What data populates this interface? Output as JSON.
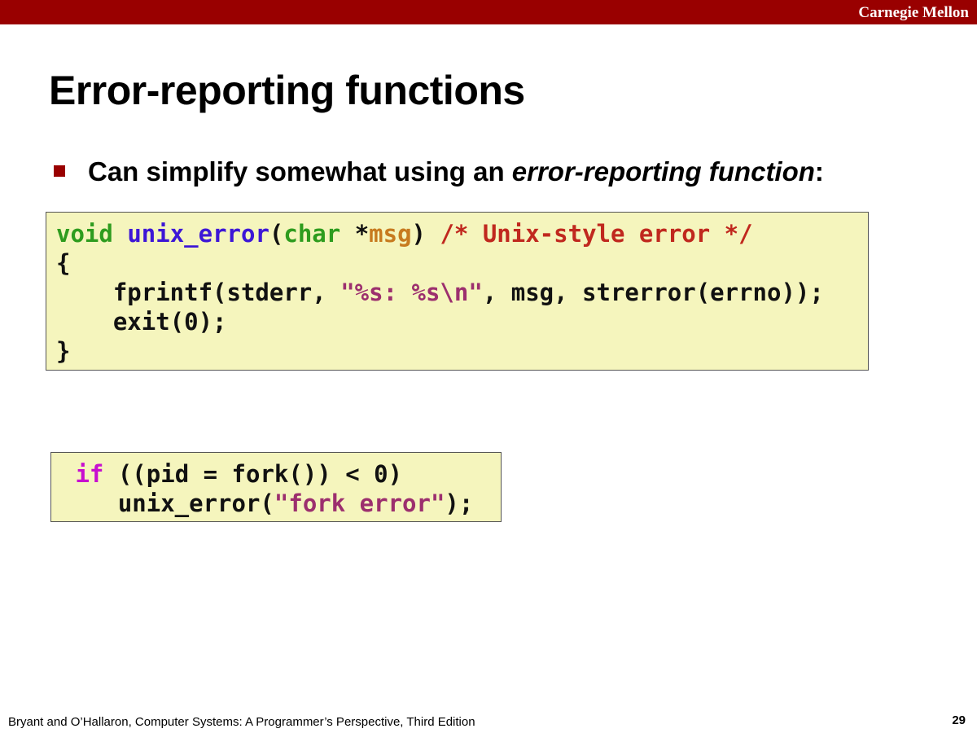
{
  "header": {
    "brand": "Carnegie Mellon"
  },
  "slide": {
    "title": "Error-reporting functions",
    "bullet": {
      "before": "Can simplify somewhat using an ",
      "emphasis": "error-reporting function",
      "after": ":"
    },
    "code_block_1": {
      "line1": {
        "t1": "void",
        "t2": " ",
        "t3": "unix_error",
        "t4": "(",
        "t5": "char",
        "t6": " *",
        "t7": "msg",
        "t8": ") ",
        "t9": "/* Unix-style error */"
      },
      "line2": "{",
      "line3": {
        "t1": "    fprintf(stderr, ",
        "t2": "\"%s: %s\\n\"",
        "t3": ", msg, strerror(errno));"
      },
      "line4": "    exit(0);",
      "line5": "}"
    },
    "code_block_2": {
      "line1": {
        "t1": " ",
        "t2": "if",
        "t3": " ((pid = fork()) < 0)"
      },
      "line2": {
        "t1": "    unix_error(",
        "t2": "\"fork error\"",
        "t3": ");"
      }
    }
  },
  "footer": {
    "citation": "Bryant and O’Hallaron, Computer Systems: A Programmer’s Perspective, Third Edition",
    "page_number": "29"
  },
  "colors": {
    "brand_red": "#990000",
    "code_background": "#f5f5bd",
    "type_keyword": "#2e9c1e",
    "function_name": "#3d17d6",
    "parameter": "#c77a1e",
    "comment": "#c0281e",
    "string": "#9c2f6e",
    "control_keyword": "#c70fcf"
  }
}
